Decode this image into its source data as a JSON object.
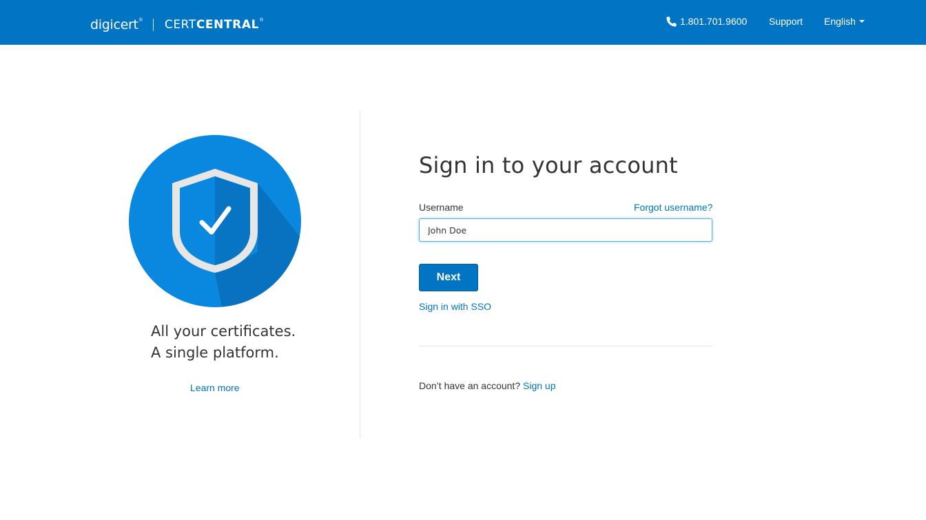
{
  "header": {
    "brand_name": "digicert",
    "brand_mark": "®",
    "product_prefix": "CERT",
    "product_suffix": "CENTRAL",
    "product_mark": "®",
    "phone": "1.801.701.9600",
    "phone_icon": "phone-icon",
    "support_label": "Support",
    "language_label": "English",
    "background_color": "#0174c3"
  },
  "hero": {
    "icon": "shield-check-icon",
    "tagline_line1": "All your certificates.",
    "tagline_line2": "A single platform.",
    "learn_more_label": "Learn more"
  },
  "form": {
    "title": "Sign in to your account",
    "username_label": "Username",
    "forgot_label": "Forgot username?",
    "username_value": "John Doe",
    "next_label": "Next",
    "sso_label": "Sign in with SSO",
    "no_account_text": "Don’t have an account?",
    "signup_label": "Sign up"
  },
  "colors": {
    "accent": "#0174c3",
    "circle": "#0a87de",
    "shadow": "#0872c0"
  }
}
